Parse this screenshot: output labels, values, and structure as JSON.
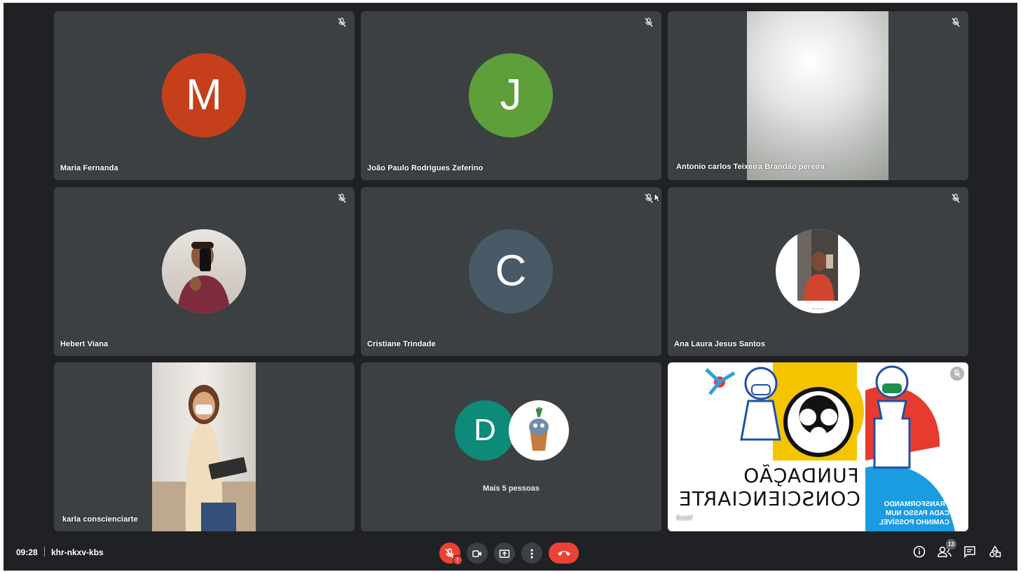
{
  "tiles": [
    {
      "name": "Maria Fernanda",
      "avatar_letter": "M",
      "avatar_color": "#c5401a"
    },
    {
      "name": "João Paulo Rodrigues Zeferino",
      "avatar_letter": "J",
      "avatar_color": "#5f9f39"
    },
    {
      "name": "Antonio carlos Teixeira Brandão pereira"
    },
    {
      "name": "Hebert Viana"
    },
    {
      "name": "Cristiane Trindade",
      "avatar_letter": "C",
      "avatar_color": "#475a66"
    },
    {
      "name": "Ana Laura Jesus Santos"
    },
    {
      "name": "karla conscienciarte"
    },
    {
      "more_label": "Mais 5 pessoas",
      "avatar_letter": "D",
      "avatar_color": "#0d8a78"
    },
    {
      "name": "Você",
      "screen_text_1": "FUNDAÇÃO",
      "screen_text_2": "CONSCIENCIARTE",
      "screen_text_3": "TRANSFORMANDO CADA PASSO NUM CAMINHO POSSÍVEL"
    }
  ],
  "bottom_bar": {
    "time": "09:28",
    "meeting_code": "khr-nkxv-kbs",
    "participants_count": "13"
  },
  "colors": {
    "background": "#202124",
    "tile": "#3c4043",
    "danger": "#ea4335"
  }
}
